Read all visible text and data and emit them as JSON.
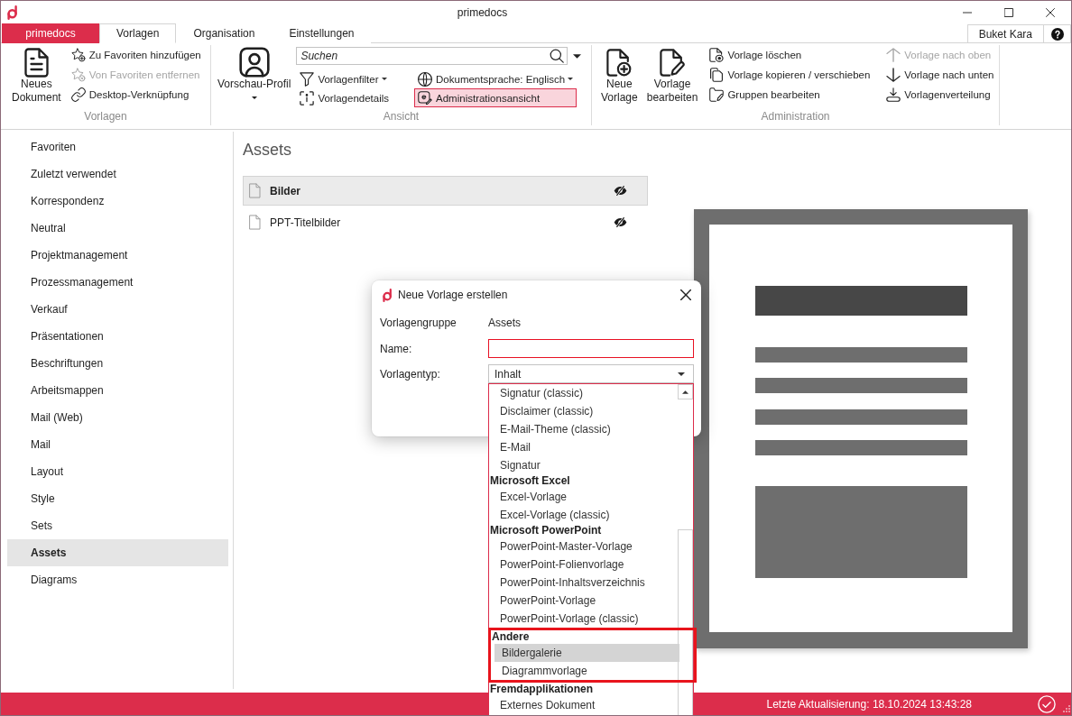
{
  "window": {
    "title": "primedocs"
  },
  "ribbon_tabs": [
    {
      "label": "primedocs",
      "kind": "app",
      "selected": false
    },
    {
      "label": "Vorlagen",
      "kind": "tab",
      "selected": true
    },
    {
      "label": "Organisation",
      "kind": "tab",
      "selected": false
    },
    {
      "label": "Einstellungen",
      "kind": "tab",
      "selected": false
    }
  ],
  "user": {
    "name": "Buket Kara"
  },
  "ribbon": {
    "groups": [
      {
        "label": "Vorlagen",
        "large": [
          {
            "label": "Neues\nDokument"
          }
        ],
        "columns": [
          [
            {
              "label": "Zu Favoriten hinzufügen",
              "disabled": false
            },
            {
              "label": "Von Favoriten entfernen",
              "disabled": true
            },
            {
              "label": "Desktop-Verknüpfung",
              "disabled": false
            }
          ]
        ]
      },
      {
        "label": "Ansicht",
        "large": [
          {
            "label": "Vorschau-Profil",
            "dropdown": true
          }
        ],
        "search": {
          "placeholder": "Suchen"
        },
        "columns": [
          [
            {
              "label": "Vorlagenfilter",
              "dropdown": true,
              "disabled": false,
              "on": false
            },
            {
              "label": "Vorlagendetails",
              "disabled": false,
              "on": false
            }
          ],
          [
            {
              "label": "Dokumentsprache: Englisch",
              "dropdown": true,
              "disabled": false,
              "on": false
            },
            {
              "label": "Administrationsansicht",
              "disabled": false,
              "on": true
            }
          ]
        ]
      },
      {
        "label": "Administration",
        "large": [
          {
            "label": "Neue\nVorlage"
          },
          {
            "label": "Vorlage\nbearbeiten"
          }
        ],
        "columns": [
          [
            {
              "label": "Vorlage löschen",
              "disabled": false
            },
            {
              "label": "Vorlage kopieren / verschieben",
              "disabled": false
            },
            {
              "label": "Gruppen bearbeiten",
              "disabled": false
            }
          ],
          [
            {
              "label": "Vorlage nach oben",
              "disabled": true
            },
            {
              "label": "Vorlage nach unten",
              "disabled": false
            },
            {
              "label": "Vorlagenverteilung",
              "disabled": false
            }
          ]
        ]
      }
    ]
  },
  "sidebar": {
    "items": [
      {
        "label": "Favoriten",
        "selected": false
      },
      {
        "label": "Zuletzt verwendet",
        "selected": false
      },
      {
        "label": "Korrespondenz",
        "selected": false
      },
      {
        "label": "Neutral",
        "selected": false
      },
      {
        "label": "Projektmanagement",
        "selected": false
      },
      {
        "label": "Prozessmanagement",
        "selected": false
      },
      {
        "label": "Verkauf",
        "selected": false
      },
      {
        "label": "Präsentationen",
        "selected": false
      },
      {
        "label": "Beschriftungen",
        "selected": false
      },
      {
        "label": "Arbeitsmappen",
        "selected": false
      },
      {
        "label": "Mail (Web)",
        "selected": false
      },
      {
        "label": "Mail",
        "selected": false
      },
      {
        "label": "Layout",
        "selected": false
      },
      {
        "label": "Style",
        "selected": false
      },
      {
        "label": "Sets",
        "selected": false
      },
      {
        "label": "Assets",
        "selected": true
      },
      {
        "label": "Diagrams",
        "selected": false
      }
    ]
  },
  "content": {
    "title": "Assets",
    "rows": [
      {
        "label": "Bilder",
        "selected": true,
        "hidden": true
      },
      {
        "label": "PPT-Titelbilder",
        "selected": false,
        "hidden": true
      }
    ]
  },
  "dialog": {
    "title": "Neue Vorlage erstellen",
    "fields": [
      {
        "kind": "static",
        "label": "Vorlagengruppe",
        "value": "Assets"
      },
      {
        "kind": "text",
        "label": "Name:",
        "error": true
      },
      {
        "kind": "select",
        "label": "Vorlagentyp:",
        "value": "Inhalt",
        "expanded": true,
        "options": [
          {
            "highlighted": false,
            "items": [
              {
                "label": "Signatur (classic)",
                "selected": false
              },
              {
                "label": "Disclaimer (classic)",
                "selected": false
              },
              {
                "label": "E-Mail-Theme (classic)",
                "selected": false
              },
              {
                "label": "E-Mail",
                "selected": false
              },
              {
                "label": "Signatur",
                "selected": false
              }
            ]
          },
          {
            "label": "Microsoft Excel",
            "highlighted": false,
            "items": [
              {
                "label": "Excel-Vorlage",
                "selected": false
              },
              {
                "label": "Excel-Vorlage (classic)",
                "selected": false
              }
            ]
          },
          {
            "label": "Microsoft PowerPoint",
            "highlighted": false,
            "items": [
              {
                "label": "PowerPoint-Master-Vorlage",
                "selected": false
              },
              {
                "label": "PowerPoint-Folienvorlage",
                "selected": false
              },
              {
                "label": "PowerPoint-Inhaltsverzeichnis",
                "selected": false
              },
              {
                "label": "PowerPoint-Vorlage",
                "selected": false
              },
              {
                "label": "PowerPoint-Vorlage (classic)",
                "selected": false
              }
            ]
          },
          {
            "label": "Andere",
            "highlighted": true,
            "items": [
              {
                "label": "Bildergalerie",
                "selected": true
              },
              {
                "label": "Diagrammvorlage",
                "selected": false
              }
            ]
          },
          {
            "label": "Fremdapplikationen",
            "highlighted": false,
            "items": [
              {
                "label": "Externes Dokument",
                "selected": false
              }
            ]
          }
        ]
      }
    ]
  },
  "status_bar": {
    "text": "Letzte Aktualisierung: 18.10.2024 13:43:28"
  }
}
